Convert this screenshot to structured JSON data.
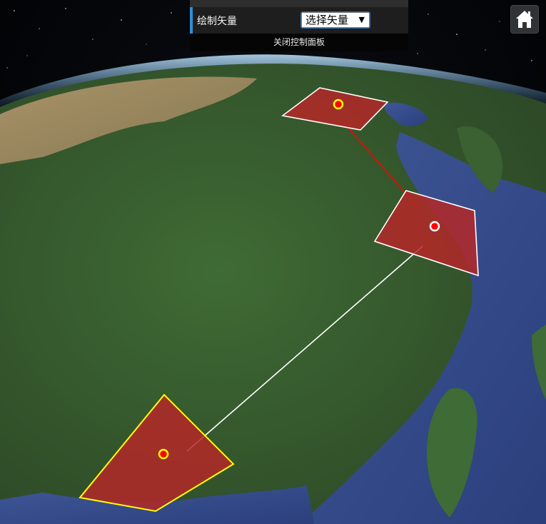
{
  "panel": {
    "draw_vector_label": "绘制矢量",
    "select_vector": {
      "selected": "选择矢量"
    },
    "close_panel_label": "关闭控制面板"
  },
  "toolbar": {
    "home_icon": "home-icon"
  },
  "colors": {
    "polygon_fill": "#b42828",
    "polygon_stroke_white": "#ffffff",
    "polygon_stroke_yellow": "#ffff00",
    "connector_red": "#ff0000",
    "connector_white": "#ffffff",
    "point_fill": "#ff0000",
    "panel_accent": "#2f8fd8"
  },
  "vectors": [
    {
      "name": "north-polygon",
      "outline": "white",
      "marker_ring": "yellow"
    },
    {
      "name": "east-polygon",
      "outline": "white",
      "marker_ring": "white"
    },
    {
      "name": "south-polygon",
      "outline": "yellow",
      "marker_ring": "yellow"
    }
  ],
  "connectors": [
    {
      "from": "north-polygon",
      "to": "east-polygon",
      "color": "red"
    },
    {
      "from": "east-polygon",
      "to": "south-polygon",
      "color": "white"
    }
  ]
}
